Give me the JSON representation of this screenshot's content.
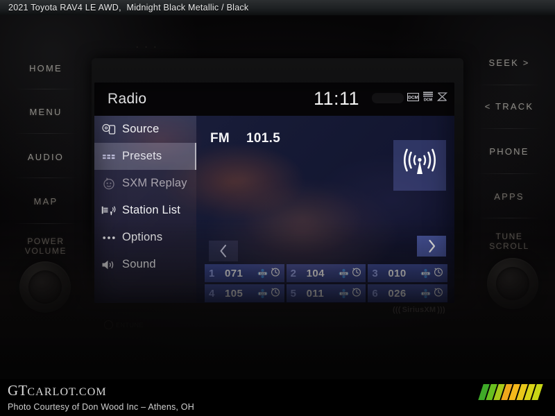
{
  "caption": {
    "vehicle": "2021 Toyota RAV4 LE AWD,",
    "colors": "Midnight Black Metallic / Black"
  },
  "head_unit": {
    "screen": {
      "title": "Radio",
      "clock": "11:11",
      "status_icons": [
        "dcm-icon",
        "dcm-signal-icon",
        "no-signal-icon"
      ],
      "band": "FM",
      "frequency": "101.5",
      "antenna_icon": "broadcast-antenna-icon",
      "prev_page_arrow": "‹",
      "next_page_arrow": "›",
      "menu": [
        {
          "label": "Source",
          "icon": "source-disc-icon",
          "state": "normal"
        },
        {
          "label": "Presets",
          "icon": "presets-grid-icon",
          "state": "selected"
        },
        {
          "label": "SXM Replay",
          "icon": "sxm-replay-icon",
          "state": "disabled"
        },
        {
          "label": "Station List",
          "icon": "station-list-icon",
          "state": "normal"
        },
        {
          "label": "Options",
          "icon": "options-dots-icon",
          "state": "normal"
        },
        {
          "label": "Sound",
          "icon": "speaker-sound-icon",
          "state": "normal"
        }
      ],
      "presets": [
        {
          "number": "1",
          "channel": "071",
          "icons": [
            "sxm-badge-icon",
            "clock-icon"
          ]
        },
        {
          "number": "2",
          "channel": "104",
          "icons": [
            "sxm-badge-icon",
            "clock-icon"
          ]
        },
        {
          "number": "3",
          "channel": "010",
          "icons": [
            "sxm-badge-icon",
            "clock-icon"
          ]
        },
        {
          "number": "4",
          "channel": "105",
          "icons": [
            "sxm-badge-icon",
            "clock-icon"
          ]
        },
        {
          "number": "5",
          "channel": "011",
          "icons": [
            "sxm-badge-icon",
            "clock-icon"
          ]
        },
        {
          "number": "6",
          "channel": "026",
          "icons": [
            "sxm-badge-icon",
            "clock-icon"
          ]
        }
      ]
    },
    "bezel": {
      "sirius_xm_label": "SiriusXM",
      "entune_label": "ENTUNE"
    }
  },
  "hard_buttons": {
    "left": [
      {
        "label": "HOME"
      },
      {
        "label": "MENU"
      },
      {
        "label": "AUDIO"
      },
      {
        "label": "MAP"
      },
      {
        "label": "POWER",
        "label2": "VOLUME"
      }
    ],
    "right": [
      {
        "label": "SEEK >"
      },
      {
        "label": "< TRACK"
      },
      {
        "label": "PHONE"
      },
      {
        "label": "APPS"
      },
      {
        "label": "TUNE",
        "label2": "SCROLL"
      }
    ]
  },
  "dash": {
    "dots": "· · ·"
  },
  "watermark": {
    "brand_gt": "GT",
    "brand_rest": "CARLOT.COM",
    "credit": "Photo Courtesy of Don Wood Inc – Athens, OH",
    "stripe_colors": [
      "#3faa28",
      "#69bf1f",
      "#a8c81a",
      "#f0a81c",
      "#f5b81b",
      "#e8c71a",
      "#d8d418",
      "#c8d616"
    ]
  },
  "colors": {
    "screen_accent": "#5a6fb0",
    "preset_blue": "#3e4e9e",
    "preset_number": "#98a7ef",
    "menu_text": "#f2f2f4"
  }
}
